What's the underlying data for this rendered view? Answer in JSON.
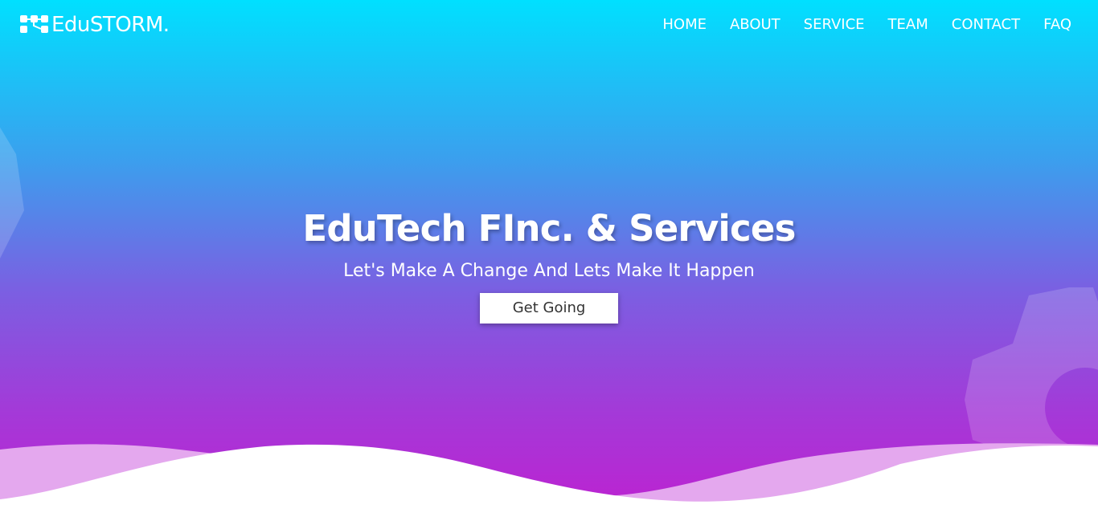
{
  "brand": {
    "name": "EduSTORM.",
    "icon": "blocks-logo-icon"
  },
  "nav": {
    "items": [
      {
        "label": "HOME"
      },
      {
        "label": "ABOUT"
      },
      {
        "label": "SERVICE"
      },
      {
        "label": "TEAM"
      },
      {
        "label": "CONTACT"
      },
      {
        "label": "FAQ"
      }
    ]
  },
  "hero": {
    "title": "EduTech FInc. & Services",
    "subtitle": "Let's Make A Change And Lets Make It Happen",
    "cta_label": "Get Going"
  },
  "colors": {
    "gradient_top": "#00e0ff",
    "gradient_bottom": "#c01fd0",
    "wave_light": "#e4a8ee",
    "white": "#ffffff"
  }
}
